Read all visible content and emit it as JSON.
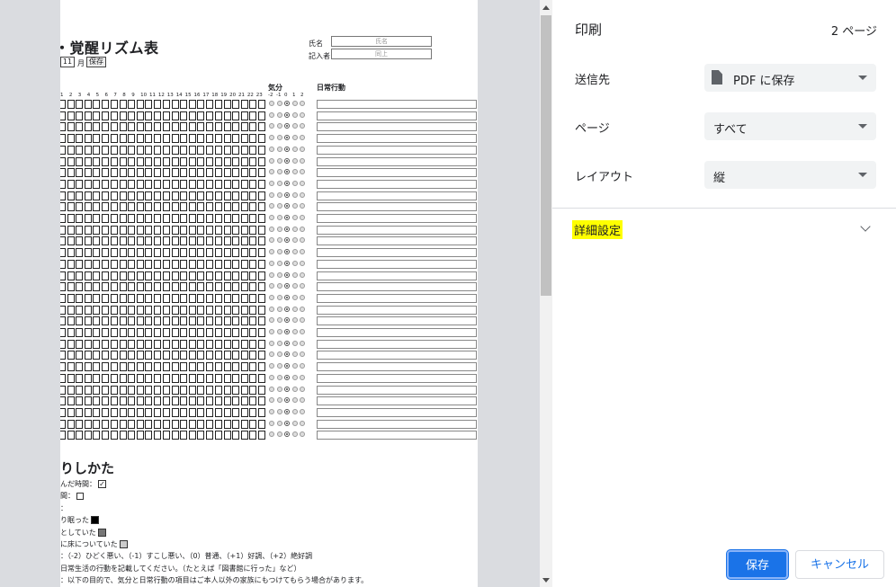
{
  "preview": {
    "sheet_title": "・覚醒リズム表",
    "name_label": "氏名",
    "name_value": "氏名",
    "recorder_label": "記入者",
    "recorder_value": "同上",
    "month_value": "11",
    "month_unit": "月",
    "save_label": "保存",
    "mood_header": "気分",
    "mood_scale": [
      "-2",
      "-1",
      "0",
      "1",
      "2"
    ],
    "activity_header": "日常行動",
    "hours": [
      "1",
      "2",
      "3",
      "4",
      "5",
      "6",
      "7",
      "8",
      "9",
      "10",
      "11",
      "12",
      "13",
      "14",
      "15",
      "16",
      "17",
      "18",
      "19",
      "20",
      "21",
      "22",
      "23"
    ],
    "howto_title": "りしかた",
    "howto_lines": [
      "んだ時間：",
      "間：",
      "：",
      "り眠った",
      "としていた",
      "に床についていた",
      "：（-2）ひどく悪い、（-1）すこし悪い、（0）普通、（+1）好調、（+2）絶好調",
      "日常生活の行動を記載してください。（たとえば「図書館に行った」など）",
      "：以下の目的で、気分と日常行動の項目はご本人以外の家族にもつけてもらう場合があります。"
    ]
  },
  "panel": {
    "title": "印刷",
    "page_count": "2 ページ",
    "destination_label": "送信先",
    "destination_value": "PDF に保存",
    "pages_label": "ページ",
    "pages_value": "すべて",
    "layout_label": "レイアウト",
    "layout_value": "縦",
    "more_settings": "詳細設定",
    "save_button": "保存",
    "cancel_button": "キャンセル"
  },
  "colors": {
    "accent": "#1a73e8",
    "highlight": "#ffff00",
    "preview_bg": "#dadce0"
  }
}
